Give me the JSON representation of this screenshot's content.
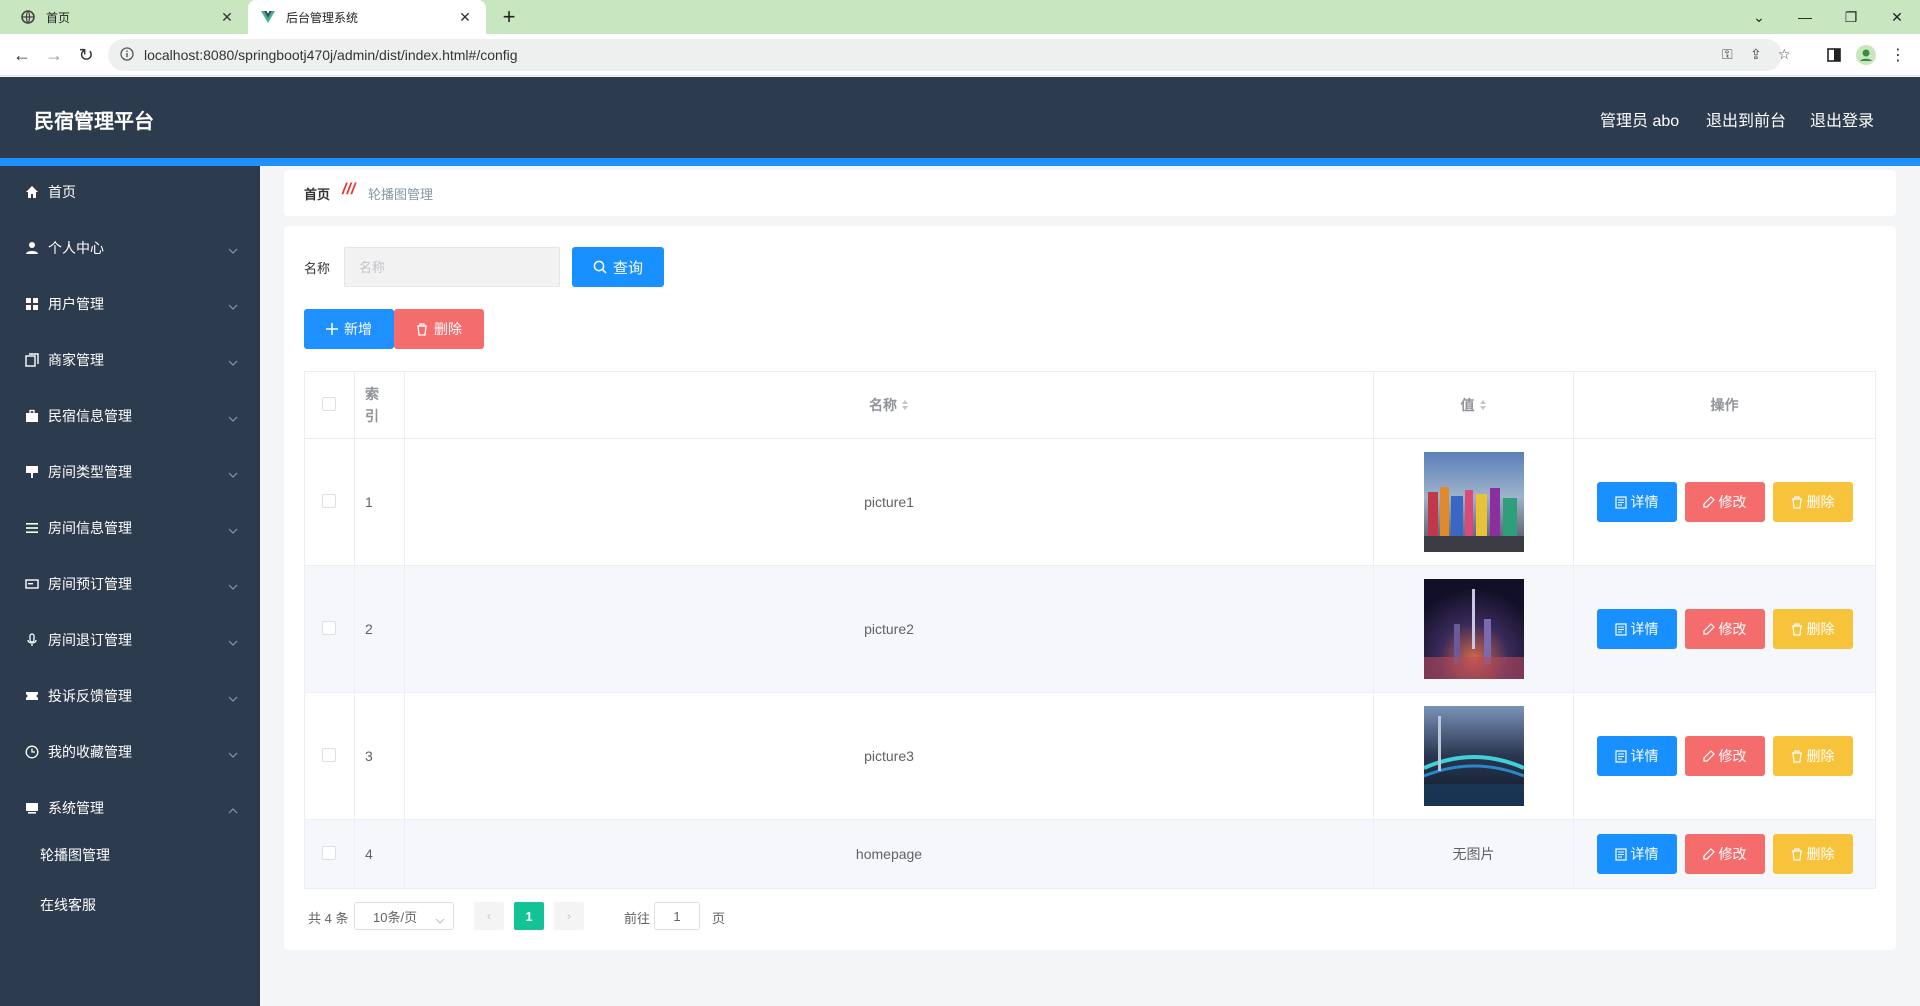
{
  "browser": {
    "tabs": [
      {
        "label": "首页",
        "icon": "globe-icon"
      },
      {
        "label": "后台管理系统",
        "icon": "vue-logo-icon"
      }
    ],
    "url": "localhost:8080/springbootj470j/admin/dist/index.html#/config"
  },
  "header": {
    "brand": "民宿管理平台",
    "admin": "管理员 abo",
    "to_front": "退出到前台",
    "logout": "退出登录"
  },
  "sidebar": {
    "items": [
      {
        "label": "首页",
        "icon": "home-icon"
      },
      {
        "label": "个人中心",
        "icon": "user-icon"
      },
      {
        "label": "用户管理",
        "icon": "grid-icon"
      },
      {
        "label": "商家管理",
        "icon": "copy-icon"
      },
      {
        "label": "民宿信息管理",
        "icon": "briefcase-icon"
      },
      {
        "label": "房间类型管理",
        "icon": "sign-icon"
      },
      {
        "label": "房间信息管理",
        "icon": "list-icon"
      },
      {
        "label": "房间预订管理",
        "icon": "card-icon"
      },
      {
        "label": "房间退订管理",
        "icon": "microphone-icon"
      },
      {
        "label": "投诉反馈管理",
        "icon": "ticket-icon"
      },
      {
        "label": "我的收藏管理",
        "icon": "clock-icon"
      },
      {
        "label": "系统管理",
        "icon": "book-icon"
      }
    ],
    "subitems": [
      {
        "label": "轮播图管理"
      },
      {
        "label": "在线客服"
      }
    ]
  },
  "breadcrumb": {
    "home": "首页",
    "separator": "///",
    "current": "轮播图管理"
  },
  "search": {
    "label": "名称",
    "placeholder": "名称",
    "query_label": "查询"
  },
  "actions": {
    "add_label": "新增",
    "delete_label": "删除"
  },
  "table": {
    "headers": {
      "index": "索引",
      "name": "名称",
      "value": "值",
      "ops": "操作"
    },
    "rows": [
      {
        "index": "1",
        "name": "picture1",
        "value": "",
        "image": "street-scene"
      },
      {
        "index": "2",
        "name": "picture2",
        "value": "",
        "image": "city-night"
      },
      {
        "index": "3",
        "name": "picture3",
        "value": "",
        "image": "bridge-lights"
      },
      {
        "index": "4",
        "name": "homepage",
        "value": "无图片",
        "image": ""
      }
    ],
    "op_labels": {
      "detail": "详情",
      "edit": "修改",
      "delete": "删除"
    }
  },
  "pagination": {
    "total": "共 4 条",
    "page_size": "10条/页",
    "current": "1",
    "goto_prefix": "前往",
    "goto_value": "1",
    "goto_suffix": "页"
  },
  "colors": {
    "header_bg": "#2d3b4e",
    "accent_blue": "#1890ff",
    "danger": "#f56c6c",
    "warning": "#f7c33a",
    "pager_active": "#13c296"
  }
}
